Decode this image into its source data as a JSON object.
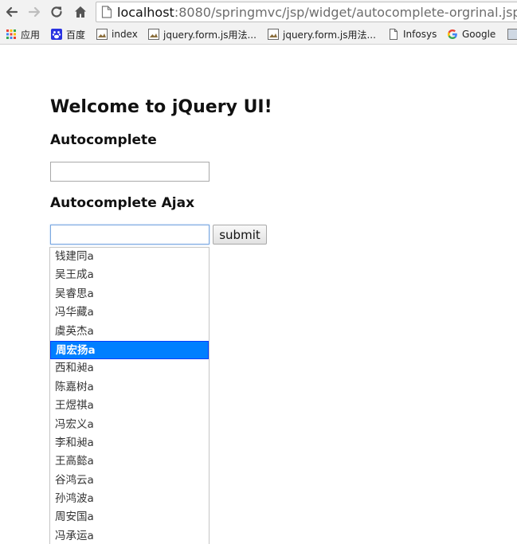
{
  "browser": {
    "url_host": "localhost",
    "url_rest": ":8080/springmvc/jsp/widget/autocomplete-orgrinal.jsp",
    "bookmarks": [
      {
        "label": "应用"
      },
      {
        "label": "百度"
      },
      {
        "label": "index"
      },
      {
        "label": "jquery.form.js用法..."
      },
      {
        "label": "jquery.form.js用法..."
      },
      {
        "label": "Infosys"
      },
      {
        "label": "Google"
      }
    ]
  },
  "page": {
    "title": "Welcome to jQuery UI!",
    "section1_title": "Autocomplete",
    "section1_input_value": "",
    "section2_title": "Autocomplete Ajax",
    "section2_input_value": "",
    "submit_label": "submit"
  },
  "autocomplete": {
    "active_index": 5,
    "items": [
      "钱建同a",
      "吴王成a",
      "吴睿思a",
      "冯华藏a",
      "虞英杰a",
      "周宏扬a",
      "西和昶a",
      "陈嘉树a",
      "王煜祺a",
      "冯宏义a",
      "李和昶a",
      "王高懿a",
      "谷鸿云a",
      "孙鸿波a",
      "周安国a",
      "冯承运a"
    ]
  },
  "colors": {
    "highlight": "#007fff",
    "focus_border": "#7aa7e0"
  }
}
